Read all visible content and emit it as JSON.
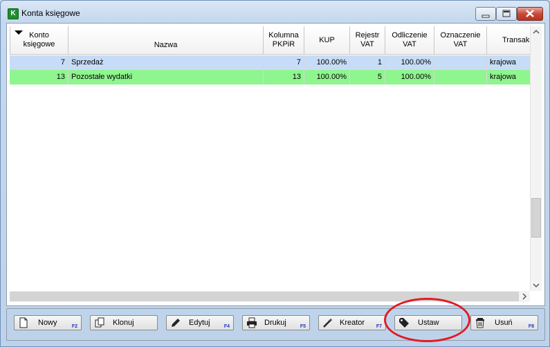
{
  "window": {
    "title": "Konta księgowe",
    "app_icon_letter": "K"
  },
  "columns": [
    {
      "label": "Konto\nksięgowe"
    },
    {
      "label": "Nazwa"
    },
    {
      "label": "Kolumna\nPKPiR"
    },
    {
      "label": "KUP"
    },
    {
      "label": "Rejestr\nVAT"
    },
    {
      "label": "Odliczenie\nVAT"
    },
    {
      "label": "Oznaczenie\nVAT"
    },
    {
      "label": "Transakcja"
    }
  ],
  "rows": [
    {
      "konto": "7",
      "nazwa": "Sprzedaż",
      "kolumna": "7",
      "kup": "100.00%",
      "rejestr": "1",
      "odliczenie": "100.00%",
      "oznaczenie": "",
      "transakcja": "krajowa"
    },
    {
      "konto": "13",
      "nazwa": "Pozostałe wydatki",
      "kolumna": "13",
      "kup": "100.00%",
      "rejestr": "5",
      "odliczenie": "100.00%",
      "oznaczenie": "",
      "transakcja": "krajowa"
    }
  ],
  "buttons": [
    {
      "label": "Nowy",
      "key": "F2",
      "icon": "new-document-icon"
    },
    {
      "label": "Klonuj",
      "key": "",
      "icon": "clone-icon"
    },
    {
      "label": "Edytuj",
      "key": "F4",
      "icon": "pencil-icon"
    },
    {
      "label": "Drukuj",
      "key": "F5",
      "icon": "printer-icon"
    },
    {
      "label": "Kreator",
      "key": "F7",
      "icon": "magic-wand-icon"
    },
    {
      "label": "Ustaw",
      "key": "",
      "icon": "tag-icon"
    },
    {
      "label": "Usuń",
      "key": "F8",
      "icon": "trash-icon"
    }
  ],
  "colors": {
    "row_selected": "#c7dcf7",
    "row_highlight": "#8ff58f",
    "annotation": "#e31b22",
    "shortcut_key": "#1d36c8"
  }
}
